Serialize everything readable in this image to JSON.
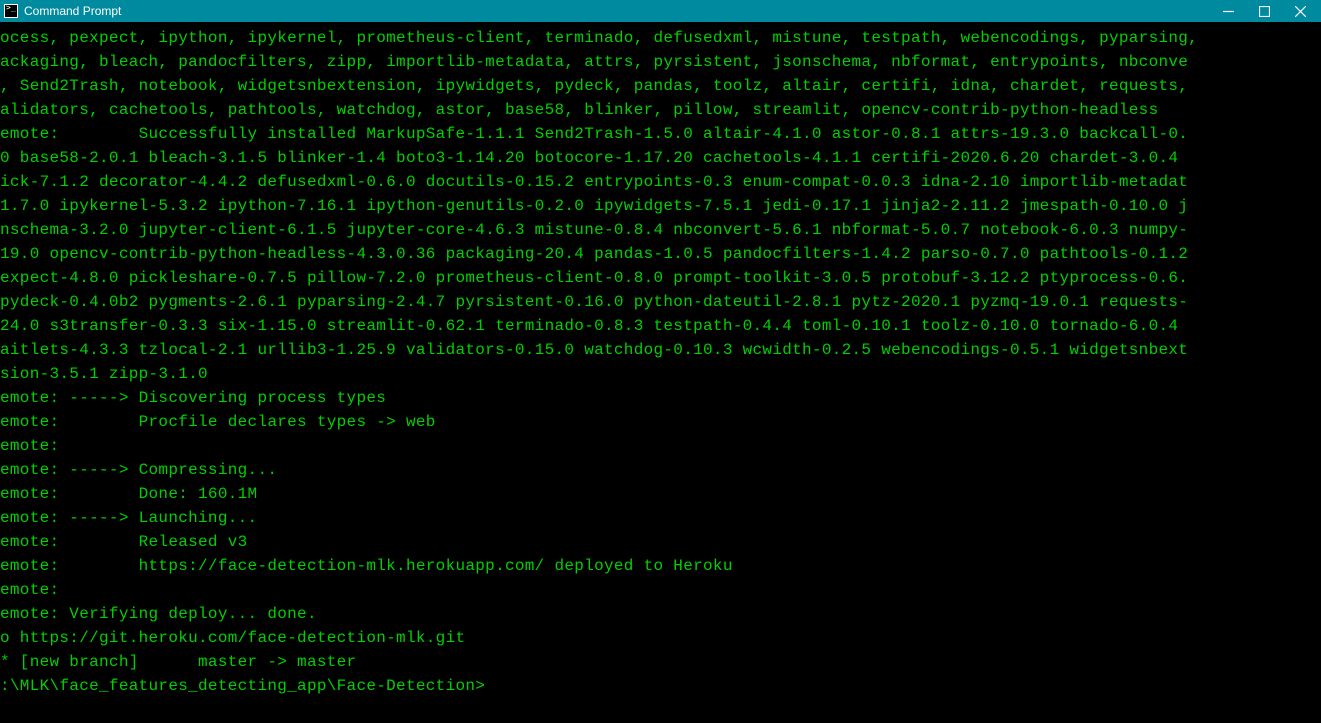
{
  "window": {
    "title": "Command Prompt"
  },
  "terminal": {
    "lines": [
      "ocess, pexpect, ipython, ipykernel, prometheus-client, terminado, defusedxml, mistune, testpath, webencodings, pyparsing,",
      "ackaging, bleach, pandocfilters, zipp, importlib-metadata, attrs, pyrsistent, jsonschema, nbformat, entrypoints, nbconve",
      ", Send2Trash, notebook, widgetsnbextension, ipywidgets, pydeck, pandas, toolz, altair, certifi, idna, chardet, requests,",
      "alidators, cachetools, pathtools, watchdog, astor, base58, blinker, pillow, streamlit, opencv-contrib-python-headless",
      "emote:        Successfully installed MarkupSafe-1.1.1 Send2Trash-1.5.0 altair-4.1.0 astor-0.8.1 attrs-19.3.0 backcall-0.",
      "0 base58-2.0.1 bleach-3.1.5 blinker-1.4 boto3-1.14.20 botocore-1.17.20 cachetools-4.1.1 certifi-2020.6.20 chardet-3.0.4",
      "ick-7.1.2 decorator-4.4.2 defusedxml-0.6.0 docutils-0.15.2 entrypoints-0.3 enum-compat-0.0.3 idna-2.10 importlib-metadat",
      "1.7.0 ipykernel-5.3.2 ipython-7.16.1 ipython-genutils-0.2.0 ipywidgets-7.5.1 jedi-0.17.1 jinja2-2.11.2 jmespath-0.10.0 j",
      "nschema-3.2.0 jupyter-client-6.1.5 jupyter-core-4.6.3 mistune-0.8.4 nbconvert-5.6.1 nbformat-5.0.7 notebook-6.0.3 numpy-",
      "19.0 opencv-contrib-python-headless-4.3.0.36 packaging-20.4 pandas-1.0.5 pandocfilters-1.4.2 parso-0.7.0 pathtools-0.1.2",
      "expect-4.8.0 pickleshare-0.7.5 pillow-7.2.0 prometheus-client-0.8.0 prompt-toolkit-3.0.5 protobuf-3.12.2 ptyprocess-0.6.",
      "pydeck-0.4.0b2 pygments-2.6.1 pyparsing-2.4.7 pyrsistent-0.16.0 python-dateutil-2.8.1 pytz-2020.1 pyzmq-19.0.1 requests-",
      "24.0 s3transfer-0.3.3 six-1.15.0 streamlit-0.62.1 terminado-0.8.3 testpath-0.4.4 toml-0.10.1 toolz-0.10.0 tornado-6.0.4",
      "aitlets-4.3.3 tzlocal-2.1 urllib3-1.25.9 validators-0.15.0 watchdog-0.10.3 wcwidth-0.2.5 webencodings-0.5.1 widgetsnbext",
      "sion-3.5.1 zipp-3.1.0",
      "emote: -----> Discovering process types",
      "emote:        Procfile declares types -> web",
      "emote:",
      "emote: -----> Compressing...",
      "emote:        Done: 160.1M",
      "emote: -----> Launching...",
      "emote:        Released v3",
      "emote:        https://face-detection-mlk.herokuapp.com/ deployed to Heroku",
      "emote:",
      "emote: Verifying deploy... done.",
      "o https://git.heroku.com/face-detection-mlk.git",
      "* [new branch]      master -> master",
      "",
      ":\\MLK\\face_features_detecting_app\\Face-Detection>"
    ]
  }
}
